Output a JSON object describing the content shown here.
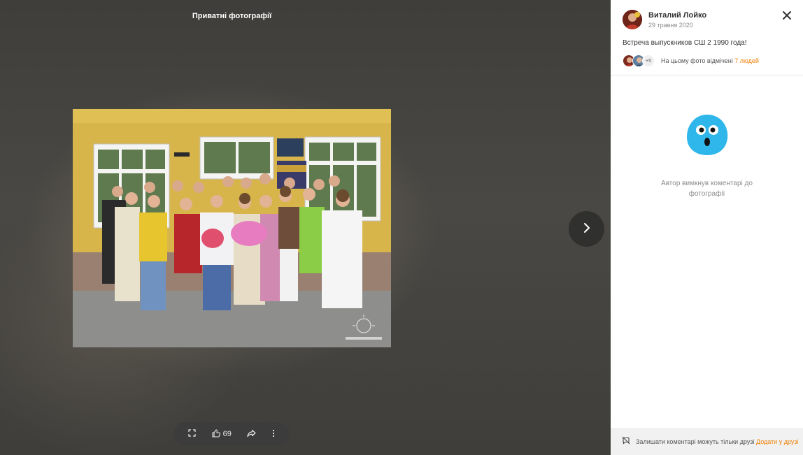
{
  "viewer": {
    "album_title": "Приватні фотографії",
    "likes_count": "69",
    "icons": {
      "fullscreen": "fullscreen-icon",
      "like": "thumbs-up-icon",
      "share": "share-icon",
      "more": "more-vertical-icon",
      "next": "chevron-right-icon"
    }
  },
  "panel": {
    "author_name": "Виталий Лойко",
    "post_date": "29 травня 2020",
    "caption": "Встреча выпускников СШ 2 1990 года!",
    "tagged": {
      "more_count": "+5",
      "text": "На цьому фото відмічені",
      "link": "7 людей"
    },
    "comments_disabled_text": "Автор вимкнув коментарі до фотографії",
    "footer": {
      "text": "Залишати коментарі можуть тільки друзі",
      "link": "Додати у друзі"
    }
  },
  "colors": {
    "accent": "#ee8208",
    "panel_bg": "#ffffff",
    "footer_bg": "#f1f1f1",
    "mascot": "#2fb6ea"
  }
}
